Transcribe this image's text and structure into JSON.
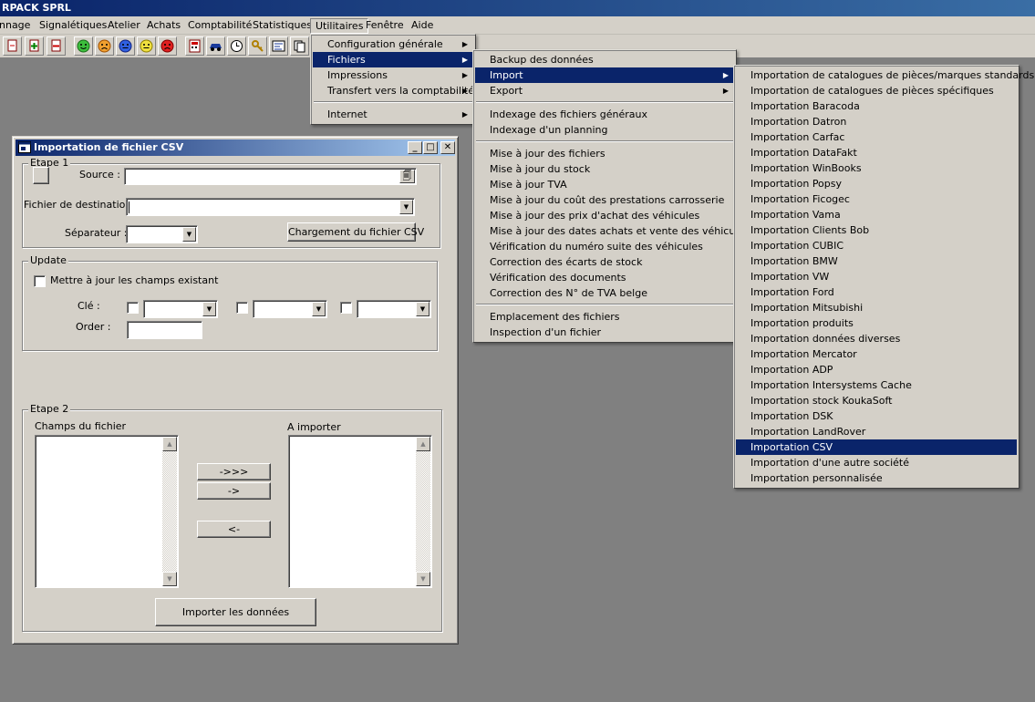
{
  "app": {
    "title": "RPACK SPRL"
  },
  "menubar": {
    "items": [
      "nnage",
      "Signalétiques",
      "Atelier",
      "Achats",
      "Comptabilité",
      "Statistiques",
      "Utilitaires",
      "Fenêtre",
      "Aide"
    ]
  },
  "utilitaires_menu": {
    "items": [
      "Configuration générale",
      "Fichiers",
      "Impressions",
      "Transfert vers la comptabilité",
      "Internet"
    ]
  },
  "fichiers_menu": {
    "items": [
      "Backup des données",
      "Import",
      "Export",
      "Indexage des fichiers généraux",
      "Indexage d'un planning",
      "Mise à jour des fichiers",
      "Mise à jour du stock",
      "Mise à jour TVA",
      "Mise à jour du coût des prestations carrosserie",
      "Mise à jour des prix d'achat des véhicules",
      "Mise à jour des dates achats et vente des véhicules",
      "Vérification du numéro suite des véhicules",
      "Correction des écarts de stock",
      "Vérification des documents",
      "Correction des N° de TVA belge",
      "Emplacement des fichiers",
      "Inspection d'un fichier"
    ]
  },
  "import_menu": {
    "items": [
      "Importation de catalogues de pièces/marques standards",
      "Importation de catalogues de pièces spécifiques",
      "Importation Baracoda",
      "Importation Datron",
      "Importation Carfac",
      "Importation DataFakt",
      "Importation WinBooks",
      "Importation Popsy",
      "Importation Ficogec",
      "Importation Vama",
      "Importation Clients Bob",
      "Importation CUBIC",
      "Importation BMW",
      "Importation VW",
      "Importation Ford",
      "Importation Mitsubishi",
      "Importation produits",
      "Importation données diverses",
      "Importation Mercator",
      "Importation ADP",
      "Importation Intersystems Cache",
      "Importation stock KoukaSoft",
      "Importation DSK",
      "Importation LandRover",
      "Importation CSV",
      "Importation d'une autre société",
      "Importation personnalisée"
    ]
  },
  "dialog": {
    "title": "Importation de fichier CSV",
    "step1": {
      "label": "Etape 1",
      "source_label": "Source :",
      "source_value": "",
      "destination_label": "Fichier de destination :",
      "destination_value": "",
      "separator_label": "Séparateur :",
      "separator_value": "",
      "load_button": "Chargement du fichier CSV"
    },
    "update": {
      "label": "Update",
      "update_checkbox_label": "Mettre à jour les champs existant",
      "key_label": "Clé :",
      "order_label": "Order :"
    },
    "step2": {
      "label": "Etape 2",
      "fields_label": "Champs du fichier",
      "import_label": "A importer",
      "btn_all": "->>>",
      "btn_one": "->",
      "btn_back": "<-",
      "import_button": "Importer les données"
    }
  },
  "colors": {
    "menu_highlight": "#0a246a",
    "face": "#d4d0c8",
    "desktop": "#808080"
  }
}
